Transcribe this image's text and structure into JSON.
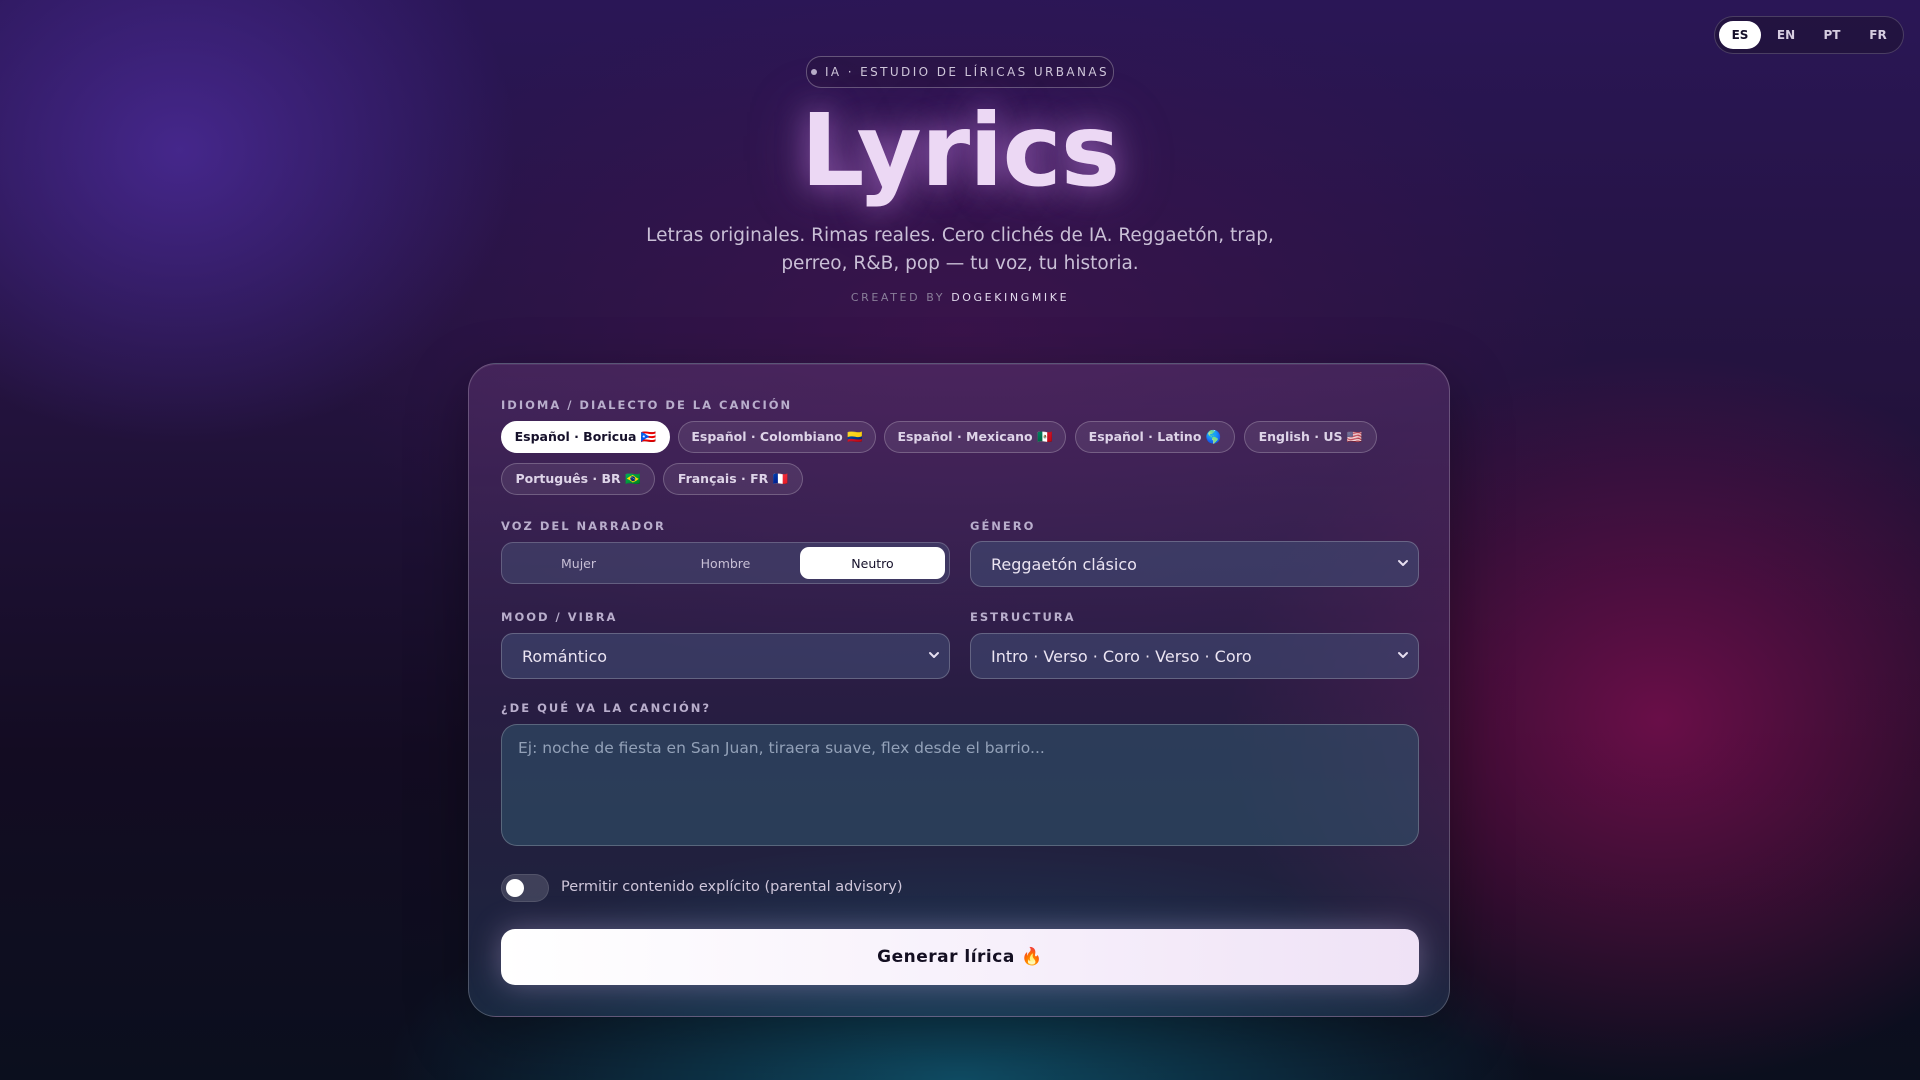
{
  "lang_switch": {
    "options": [
      "ES",
      "EN",
      "PT",
      "FR"
    ],
    "active": "ES"
  },
  "hero": {
    "eyebrow": "IA · ESTUDIO DE LÍRICAS URBANAS",
    "title": "Lyrics",
    "subtitle_line1": "Letras originales. Rimas reales. Cero clichés de IA. Reggaetón, trap,",
    "subtitle_line2": "perreo, R&B, pop — tu voz, tu historia.",
    "credit_prefix": "CREATED BY",
    "credit_name": "DOGEKINGMIKE"
  },
  "form": {
    "language_label": "IDIOMA / DIALECTO DE LA CANCIÓN",
    "languages": [
      "Español · Boricua 🇵🇷",
      "Español · Colombiano 🇨🇴",
      "Español · Mexicano 🇲🇽",
      "Español · Latino 🌎",
      "English · US 🇺🇸",
      "Português · BR 🇧🇷",
      "Français · FR 🇫🇷"
    ],
    "language_selected": "Español · Boricua 🇵🇷",
    "narrator_label": "VOZ DEL NARRADOR",
    "narrator_options": [
      "Mujer",
      "Hombre",
      "Neutro"
    ],
    "narrator_selected": "Neutro",
    "genre_label": "GÉNERO",
    "genre_value": "Reggaetón clásico",
    "mood_label": "MOOD / VIBRA",
    "mood_value": "Romántico",
    "structure_label": "ESTRUCTURA",
    "structure_value": "Intro · Verso · Coro · Verso · Coro",
    "topic_label": "¿DE QUÉ VA LA CANCIÓN?",
    "topic_placeholder": "Ej: noche de fiesta en San Juan, tiraera suave, flex desde el barrio...",
    "topic_value": "",
    "explicit_label": "Permitir contenido explícito (parental advisory)",
    "explicit_enabled": false,
    "generate_label": "Generar lírica 🔥"
  },
  "icons": {
    "select_chevron": "chevron-down-icon",
    "eyebrow_dot": "dot-icon"
  }
}
